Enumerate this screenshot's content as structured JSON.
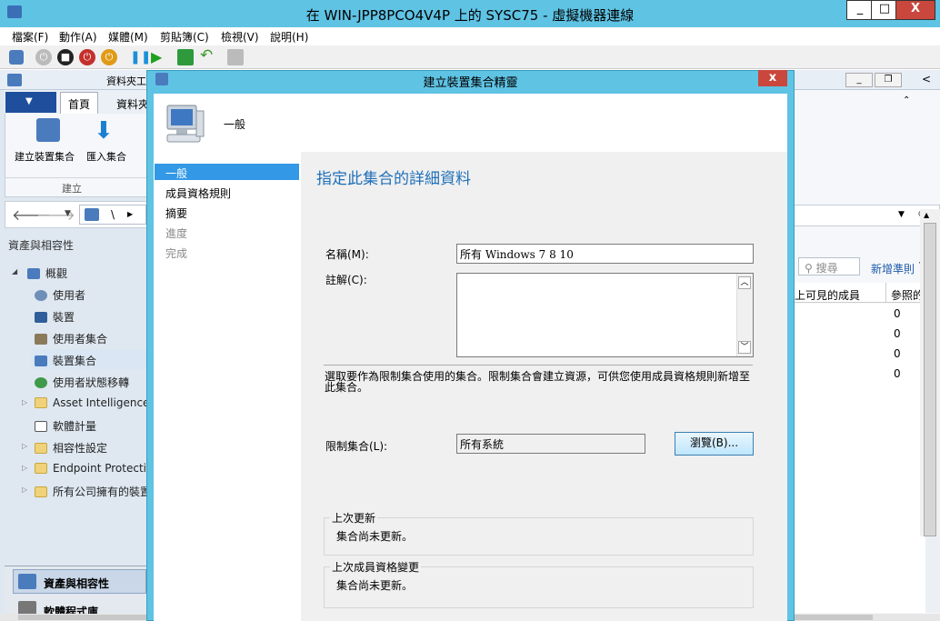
{
  "host": {
    "title": "在 WIN-JPP8PCO4V4P 上的 SYSC75 - 虛擬機器連線",
    "window_controls": [
      "_",
      "□",
      "X"
    ],
    "menu": [
      "檔案(F)",
      "動作(A)",
      "媒體(M)",
      "剪貼簿(C)",
      "檢視(V)",
      "說明(H)"
    ]
  },
  "guest": {
    "window_controls": [
      "_",
      "❐",
      "<"
    ]
  },
  "console": {
    "folder_tab_partial": "資料夾工",
    "tabs": {
      "file": "▼",
      "home": "首頁",
      "folder": "資料夾"
    },
    "ribbon_buttons": [
      "建立裝置集合",
      "匯入集合"
    ],
    "ribbon_group": "建立",
    "breadcrumb_sep": "\\",
    "workspace_title": "資產與相容性",
    "tree": {
      "root": "概觀",
      "items": [
        "使用者",
        "裝置",
        "使用者集合",
        "裝置集合",
        "使用者狀態移轉",
        "Asset Intelligence",
        "軟體計量",
        "相容性設定",
        "Endpoint Protection",
        "所有公司擁有的裝置"
      ]
    },
    "wunderbar": [
      "資產與相容性",
      "軟體程式庫"
    ],
    "search_label": "搜尋",
    "add_criteria": "新增準則",
    "columns": [
      "上可見的成員",
      "參照的"
    ],
    "values": [
      "0",
      "0",
      "0",
      "0"
    ]
  },
  "dialog": {
    "title": "建立裝置集合精靈",
    "header": "一般",
    "nav": [
      "一般",
      "成員資格規則",
      "摘要",
      "進度",
      "完成"
    ],
    "heading": "指定此集合的詳細資料",
    "name_label": "名稱(M):",
    "name_value": "所有 Windows 7 8 10",
    "comment_label": "註解(C):",
    "comment_value": "",
    "limit_desc": "選取要作為限制集合使用的集合。限制集合會建立資源，可供您使用成員資格規則新增至此集合。",
    "limit_label": "限制集合(L):",
    "limit_value": "所有系統",
    "browse_label": "瀏覽(B)...",
    "last_update_title": "上次更新",
    "last_update_value": "集合尚未更新。",
    "last_member_title": "上次成員資格變更",
    "last_member_value": "集合尚未更新。"
  }
}
